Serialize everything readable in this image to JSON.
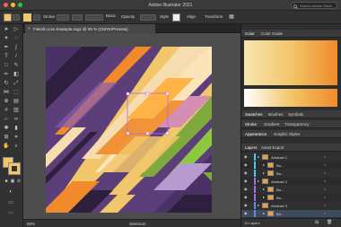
{
  "window": {
    "title": "Adobe Illustrator 2021",
    "search_placeholder": "Search Adobe Stock"
  },
  "control_bar": {
    "stroke_label": "Stroke",
    "opacity_label": "Opacity",
    "opacity_value": "Basic",
    "style_label": "Style",
    "align_label": "Align",
    "transform_label": "Transform"
  },
  "document": {
    "tab_title": "Filetofo.com Example.svgz @ 55 % (CMYK/Preview)"
  },
  "status": {
    "zoom": "55%",
    "mode": "Selection"
  },
  "panels": {
    "color_tab": "Color",
    "color_guide_tab": "Color Guide",
    "swatches_tab": "Swatches",
    "brushes_tab": "Brushes",
    "symbols_tab": "Symbols",
    "stroke_tab": "Stroke",
    "gradient_tab": "Gradient",
    "transparency_tab": "Transparency",
    "appearance_tab": "Appearance",
    "graphic_styles_tab": "Graphic Styles",
    "layers_tab": "Layers",
    "asset_export_tab": "Asset Export",
    "layers_count": "10 Layers"
  },
  "layers": [
    {
      "name": "Abstract 1",
      "level": 0,
      "color": "#3fd3e0"
    },
    {
      "name": "Ba...",
      "level": 1,
      "color": "#3fd3e0"
    },
    {
      "name": "Ba...",
      "level": 1,
      "color": "#3fd3e0"
    },
    {
      "name": "Abstract 2",
      "level": 0,
      "color": "#9a6ff0"
    },
    {
      "name": "Ba...",
      "level": 1,
      "color": "#9a6ff0"
    },
    {
      "name": "Ba...",
      "level": 1,
      "color": "#9a6ff0"
    },
    {
      "name": "Abstract 3",
      "level": 0,
      "color": "#5a8df0"
    },
    {
      "name": "Ba...",
      "level": 1,
      "color": "#5a8df0"
    }
  ],
  "colors": {
    "fill": "#f2c66a",
    "accent_orange": "#f08a2a",
    "purple": "#5c3f78"
  }
}
